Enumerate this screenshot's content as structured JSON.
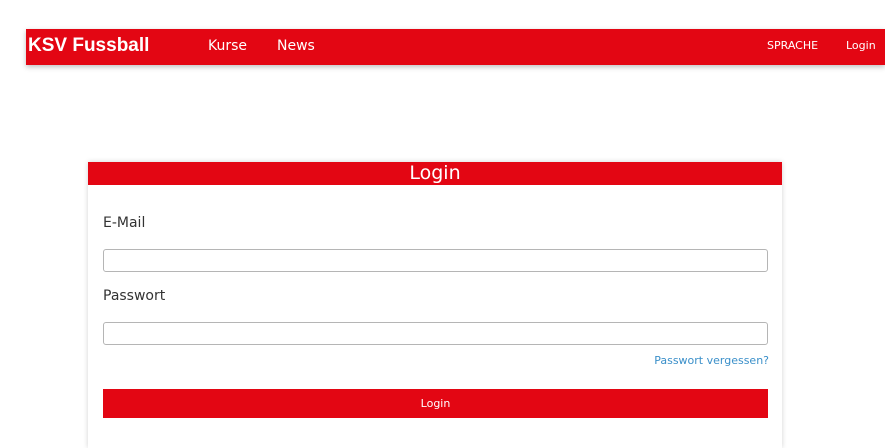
{
  "navbar": {
    "brand": "KSV Fussball",
    "links": [
      "Kurse",
      "News"
    ],
    "language_label": "SPRACHE",
    "login_label": "Login"
  },
  "login_form": {
    "title": "Login",
    "email_label": "E-Mail",
    "email_value": "",
    "password_label": "Passwort",
    "password_value": "",
    "forgot_password_label": "Passwort vergessen?",
    "submit_label": "Login"
  },
  "colors": {
    "brand_red": "#e30613",
    "link_blue": "#3a8fc9"
  }
}
